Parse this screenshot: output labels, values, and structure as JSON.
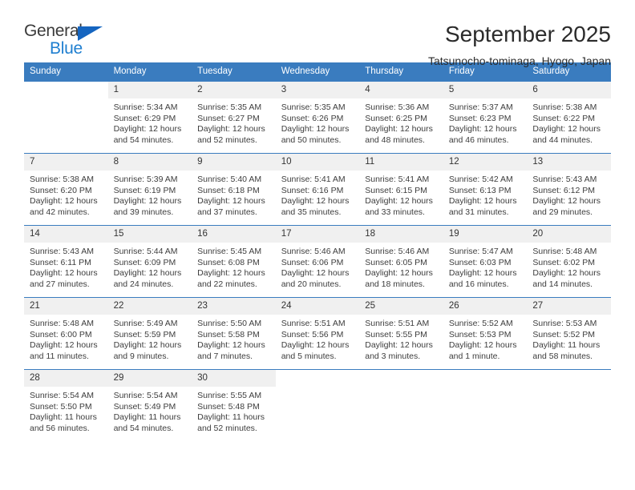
{
  "brand": {
    "word_one": "General",
    "word_two": "Blue",
    "triangle_color": "#1565c0",
    "blue_color": "#1f7fd0"
  },
  "header": {
    "title": "September 2025",
    "subtitle": "Tatsunocho-tominaga, Hyogo, Japan",
    "header_bg": "#3a7cbf",
    "header_text_color": "#ffffff"
  },
  "weekdays": [
    "Sunday",
    "Monday",
    "Tuesday",
    "Wednesday",
    "Thursday",
    "Friday",
    "Saturday"
  ],
  "weeks": [
    [
      {
        "day": "",
        "info": ""
      },
      {
        "day": "1",
        "info": "Sunrise: 5:34 AM\nSunset: 6:29 PM\nDaylight: 12 hours\nand 54 minutes."
      },
      {
        "day": "2",
        "info": "Sunrise: 5:35 AM\nSunset: 6:27 PM\nDaylight: 12 hours\nand 52 minutes."
      },
      {
        "day": "3",
        "info": "Sunrise: 5:35 AM\nSunset: 6:26 PM\nDaylight: 12 hours\nand 50 minutes."
      },
      {
        "day": "4",
        "info": "Sunrise: 5:36 AM\nSunset: 6:25 PM\nDaylight: 12 hours\nand 48 minutes."
      },
      {
        "day": "5",
        "info": "Sunrise: 5:37 AM\nSunset: 6:23 PM\nDaylight: 12 hours\nand 46 minutes."
      },
      {
        "day": "6",
        "info": "Sunrise: 5:38 AM\nSunset: 6:22 PM\nDaylight: 12 hours\nand 44 minutes."
      }
    ],
    [
      {
        "day": "7",
        "info": "Sunrise: 5:38 AM\nSunset: 6:20 PM\nDaylight: 12 hours\nand 42 minutes."
      },
      {
        "day": "8",
        "info": "Sunrise: 5:39 AM\nSunset: 6:19 PM\nDaylight: 12 hours\nand 39 minutes."
      },
      {
        "day": "9",
        "info": "Sunrise: 5:40 AM\nSunset: 6:18 PM\nDaylight: 12 hours\nand 37 minutes."
      },
      {
        "day": "10",
        "info": "Sunrise: 5:41 AM\nSunset: 6:16 PM\nDaylight: 12 hours\nand 35 minutes."
      },
      {
        "day": "11",
        "info": "Sunrise: 5:41 AM\nSunset: 6:15 PM\nDaylight: 12 hours\nand 33 minutes."
      },
      {
        "day": "12",
        "info": "Sunrise: 5:42 AM\nSunset: 6:13 PM\nDaylight: 12 hours\nand 31 minutes."
      },
      {
        "day": "13",
        "info": "Sunrise: 5:43 AM\nSunset: 6:12 PM\nDaylight: 12 hours\nand 29 minutes."
      }
    ],
    [
      {
        "day": "14",
        "info": "Sunrise: 5:43 AM\nSunset: 6:11 PM\nDaylight: 12 hours\nand 27 minutes."
      },
      {
        "day": "15",
        "info": "Sunrise: 5:44 AM\nSunset: 6:09 PM\nDaylight: 12 hours\nand 24 minutes."
      },
      {
        "day": "16",
        "info": "Sunrise: 5:45 AM\nSunset: 6:08 PM\nDaylight: 12 hours\nand 22 minutes."
      },
      {
        "day": "17",
        "info": "Sunrise: 5:46 AM\nSunset: 6:06 PM\nDaylight: 12 hours\nand 20 minutes."
      },
      {
        "day": "18",
        "info": "Sunrise: 5:46 AM\nSunset: 6:05 PM\nDaylight: 12 hours\nand 18 minutes."
      },
      {
        "day": "19",
        "info": "Sunrise: 5:47 AM\nSunset: 6:03 PM\nDaylight: 12 hours\nand 16 minutes."
      },
      {
        "day": "20",
        "info": "Sunrise: 5:48 AM\nSunset: 6:02 PM\nDaylight: 12 hours\nand 14 minutes."
      }
    ],
    [
      {
        "day": "21",
        "info": "Sunrise: 5:48 AM\nSunset: 6:00 PM\nDaylight: 12 hours\nand 11 minutes."
      },
      {
        "day": "22",
        "info": "Sunrise: 5:49 AM\nSunset: 5:59 PM\nDaylight: 12 hours\nand 9 minutes."
      },
      {
        "day": "23",
        "info": "Sunrise: 5:50 AM\nSunset: 5:58 PM\nDaylight: 12 hours\nand 7 minutes."
      },
      {
        "day": "24",
        "info": "Sunrise: 5:51 AM\nSunset: 5:56 PM\nDaylight: 12 hours\nand 5 minutes."
      },
      {
        "day": "25",
        "info": "Sunrise: 5:51 AM\nSunset: 5:55 PM\nDaylight: 12 hours\nand 3 minutes."
      },
      {
        "day": "26",
        "info": "Sunrise: 5:52 AM\nSunset: 5:53 PM\nDaylight: 12 hours\nand 1 minute."
      },
      {
        "day": "27",
        "info": "Sunrise: 5:53 AM\nSunset: 5:52 PM\nDaylight: 11 hours\nand 58 minutes."
      }
    ],
    [
      {
        "day": "28",
        "info": "Sunrise: 5:54 AM\nSunset: 5:50 PM\nDaylight: 11 hours\nand 56 minutes."
      },
      {
        "day": "29",
        "info": "Sunrise: 5:54 AM\nSunset: 5:49 PM\nDaylight: 11 hours\nand 54 minutes."
      },
      {
        "day": "30",
        "info": "Sunrise: 5:55 AM\nSunset: 5:48 PM\nDaylight: 11 hours\nand 52 minutes."
      },
      {
        "day": "",
        "info": ""
      },
      {
        "day": "",
        "info": ""
      },
      {
        "day": "",
        "info": ""
      },
      {
        "day": "",
        "info": ""
      }
    ]
  ]
}
